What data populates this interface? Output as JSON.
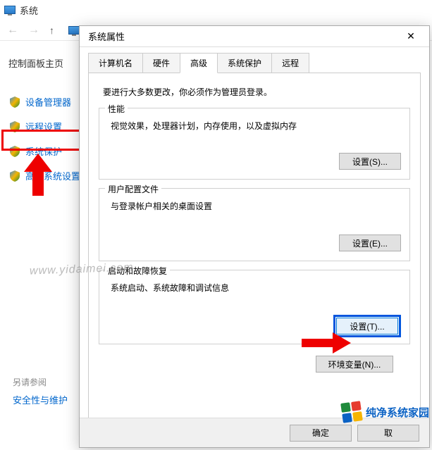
{
  "bgWindow": {
    "title": "系统"
  },
  "sidebar": {
    "home": "控制面板主页",
    "items": [
      {
        "label": "设备管理器"
      },
      {
        "label": "远程设置"
      },
      {
        "label": "系统保护"
      },
      {
        "label": "高级系统设置"
      }
    ],
    "seeAlso": "另请参阅",
    "seeAlsoLink": "安全性与维护"
  },
  "dialog": {
    "title": "系统属性",
    "tabs": [
      {
        "label": "计算机名"
      },
      {
        "label": "硬件"
      },
      {
        "label": "高级"
      },
      {
        "label": "系统保护"
      },
      {
        "label": "远程"
      }
    ],
    "activeTab": 2,
    "note": "要进行大多数更改，你必须作为管理员登录。",
    "groups": {
      "performance": {
        "legend": "性能",
        "desc": "视觉效果，处理器计划，内存使用，以及虚拟内存",
        "btn": "设置(S)..."
      },
      "userProfile": {
        "legend": "用户配置文件",
        "desc": "与登录帐户相关的桌面设置",
        "btn": "设置(E)..."
      },
      "startup": {
        "legend": "启动和故障恢复",
        "desc": "系统启动、系统故障和调试信息",
        "btn": "设置(T)..."
      }
    },
    "envBtn": "环境变量(N)...",
    "footer": {
      "ok": "确定",
      "cancel": "取"
    }
  },
  "watermark": {
    "url": "www.yidaimei.com",
    "logoText": "纯净系统家园"
  }
}
